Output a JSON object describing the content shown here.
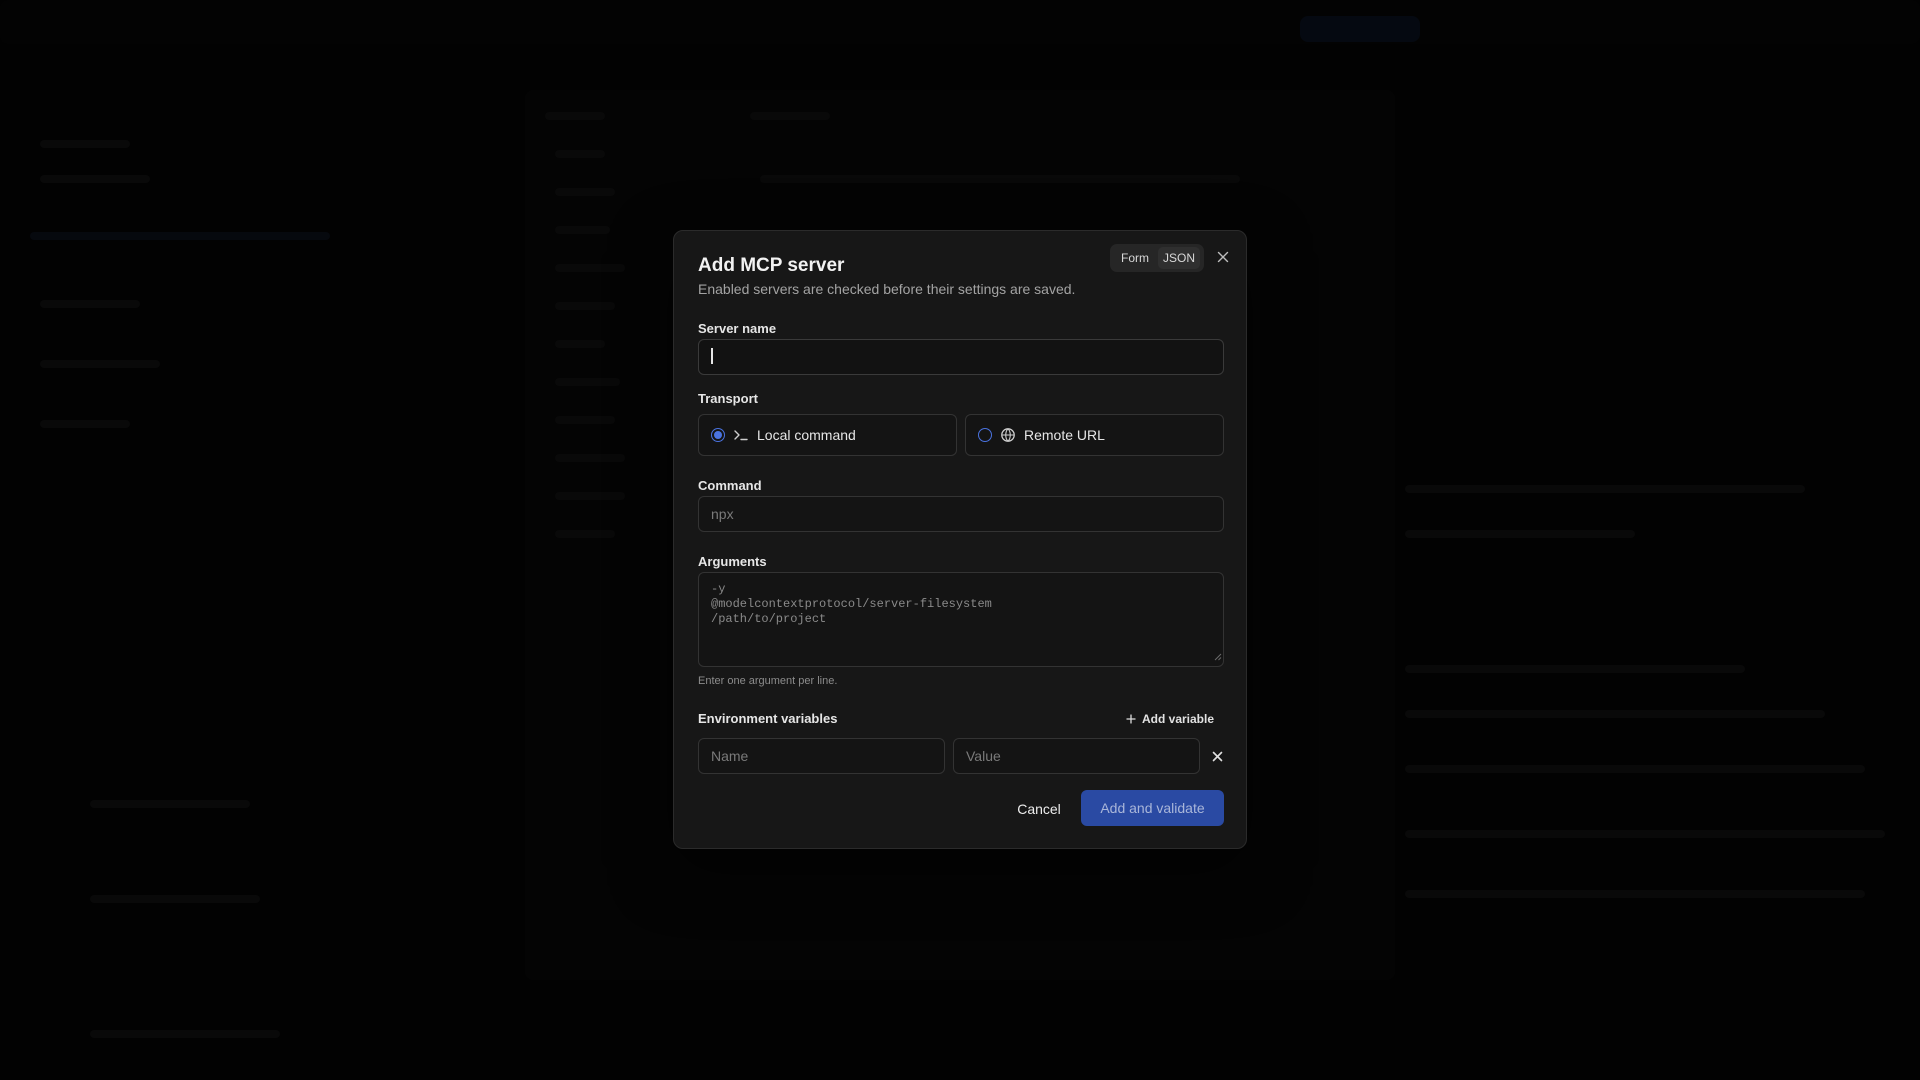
{
  "dialog": {
    "title": "Add MCP server",
    "subtitle": "Enabled servers are checked before their settings are saved.",
    "mode_toggle": {
      "options": [
        "Form",
        "JSON"
      ],
      "selected": "JSON"
    },
    "close_icon": "close-icon"
  },
  "form": {
    "server_name": {
      "label": "Server name",
      "value": ""
    },
    "transport": {
      "label": "Transport",
      "options": [
        {
          "label": "Local command",
          "icon": "terminal-icon",
          "checked": true
        },
        {
          "label": "Remote URL",
          "icon": "globe-icon",
          "checked": false
        }
      ]
    },
    "command": {
      "label": "Command",
      "placeholder": "npx"
    },
    "arguments": {
      "label": "Arguments",
      "placeholder": "-y\n@modelcontextprotocol/server-filesystem\n/path/to/project",
      "hint": "Enter one argument per line."
    },
    "env": {
      "label": "Environment variables",
      "add_label": "Add variable",
      "name_placeholder": "Name",
      "value_placeholder": "Value"
    }
  },
  "actions": {
    "cancel_label": "Cancel",
    "submit_label": "Add and validate"
  },
  "colors": {
    "accent": "#4a73e0",
    "primary_button": "#2a4aa3",
    "surface": "#171717",
    "backdrop": "#050505"
  }
}
